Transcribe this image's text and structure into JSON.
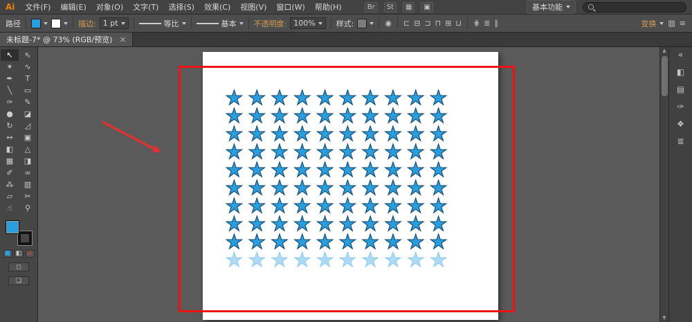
{
  "menubar": {
    "logo": "Ai",
    "items": [
      "文件(F)",
      "编辑(E)",
      "对象(O)",
      "文字(T)",
      "选择(S)",
      "效果(C)",
      "视图(V)",
      "窗口(W)",
      "帮助(H)"
    ],
    "appbar_icons": [
      {
        "name": "bridge-icon",
        "glyph": "Br"
      },
      {
        "name": "stock-icon",
        "glyph": "St"
      },
      {
        "name": "arrange-documents-icon",
        "glyph": "▦"
      },
      {
        "name": "screen-mode-icon",
        "glyph": "▣"
      }
    ],
    "workspace_switcher": "基本功能",
    "search_placeholder": ""
  },
  "controlbar": {
    "context_label": "路径",
    "stroke_label": "描边:",
    "stroke_value": "1 pt",
    "profile_label": "等比",
    "brush_label": "基本",
    "opacity_label": "不透明度:",
    "opacity_value": "100%",
    "style_label": "样式:",
    "transform_label": "变换",
    "recolor_glyph": "◉",
    "align_icons": [
      {
        "name": "align-left-icon",
        "glyph": "⊏"
      },
      {
        "name": "align-center-horizontal-icon",
        "glyph": "⊟"
      },
      {
        "name": "align-right-icon",
        "glyph": "⊐"
      },
      {
        "name": "align-top-icon",
        "glyph": "⊓"
      },
      {
        "name": "align-middle-vertical-icon",
        "glyph": "⊞"
      },
      {
        "name": "align-bottom-icon",
        "glyph": "⊔"
      }
    ],
    "distribute_icons": [
      {
        "name": "distribute-horizontal-icon",
        "glyph": "⋕"
      },
      {
        "name": "distribute-vertical-icon",
        "glyph": "≣"
      },
      {
        "name": "distribute-spacing-icon",
        "glyph": "∥"
      }
    ],
    "right_icons": [
      {
        "name": "graph-options-icon",
        "glyph": "▥"
      },
      {
        "name": "more-options-icon",
        "glyph": "≡"
      }
    ]
  },
  "tab": {
    "title": "未标题-7* @ 73% (RGB/预览)",
    "close_glyph": "×"
  },
  "tools": [
    {
      "name": "selection-tool",
      "glyph": "↖"
    },
    {
      "name": "direct-selection-tool",
      "glyph": "⇖"
    },
    {
      "name": "magic-wand-tool",
      "glyph": "✶"
    },
    {
      "name": "lasso-tool",
      "glyph": "∿"
    },
    {
      "name": "pen-tool",
      "glyph": "✒"
    },
    {
      "name": "type-tool",
      "glyph": "T"
    },
    {
      "name": "line-segment-tool",
      "glyph": "╲"
    },
    {
      "name": "rectangle-tool",
      "glyph": "▭"
    },
    {
      "name": "paintbrush-tool",
      "glyph": "✑"
    },
    {
      "name": "pencil-tool",
      "glyph": "✎"
    },
    {
      "name": "blob-brush-tool",
      "glyph": "●"
    },
    {
      "name": "eraser-tool",
      "glyph": "◪"
    },
    {
      "name": "rotate-tool",
      "glyph": "↻"
    },
    {
      "name": "scale-tool",
      "glyph": "◿"
    },
    {
      "name": "width-tool",
      "glyph": "↔"
    },
    {
      "name": "free-transform-tool",
      "glyph": "▣"
    },
    {
      "name": "shape-builder-tool",
      "glyph": "◧"
    },
    {
      "name": "perspective-grid-tool",
      "glyph": "△"
    },
    {
      "name": "mesh-tool",
      "glyph": "▦"
    },
    {
      "name": "gradient-tool",
      "glyph": "◨"
    },
    {
      "name": "eyedropper-tool",
      "glyph": "✐"
    },
    {
      "name": "blend-tool",
      "glyph": "∞"
    },
    {
      "name": "symbol-sprayer-tool",
      "glyph": "⁂"
    },
    {
      "name": "column-graph-tool",
      "glyph": "▥"
    },
    {
      "name": "artboard-tool",
      "glyph": "▱"
    },
    {
      "name": "slice-tool",
      "glyph": "✂"
    },
    {
      "name": "hand-tool",
      "glyph": "☝"
    },
    {
      "name": "zoom-tool",
      "glyph": "⚲"
    }
  ],
  "toolpanel_bottom": {
    "mini_buttons": [
      {
        "name": "color-button",
        "glyph": "■",
        "color": "#2B9FDD"
      },
      {
        "name": "gradient-button",
        "glyph": "◧"
      },
      {
        "name": "none-button",
        "glyph": "⊘",
        "color": "#d44a3a"
      }
    ],
    "wide_buttons": [
      {
        "name": "drawing-modes-button",
        "glyph": "◻"
      },
      {
        "name": "change-screen-mode-button",
        "glyph": "❏"
      }
    ]
  },
  "canvas": {
    "stars": {
      "glyph": "★",
      "rows": 10,
      "cols": 10,
      "fill": "#2B9FDD",
      "stroke": "#174F79",
      "faded_fill": "#6FBDEF",
      "faded_opacity": 0.55,
      "faded_last_row": true
    },
    "annotation": {
      "rect_color": "#EE1212",
      "arrow_color": "#E03131"
    }
  },
  "scrollbar": {
    "up_glyph": "▲",
    "down_glyph": "▼"
  },
  "dock_icons": [
    {
      "name": "collapse-panels-icon",
      "glyph": "«"
    },
    {
      "name": "color-panel-icon",
      "glyph": "◧"
    },
    {
      "name": "swatches-panel-icon",
      "glyph": "▤"
    },
    {
      "name": "brushes-panel-icon",
      "glyph": "✑"
    },
    {
      "name": "symbols-panel-icon",
      "glyph": "❖"
    },
    {
      "name": "layers-panel-icon",
      "glyph": "≣"
    }
  ],
  "colors": {
    "fill_blue": "#2B9FDD",
    "accent_link": "#D49C54"
  }
}
